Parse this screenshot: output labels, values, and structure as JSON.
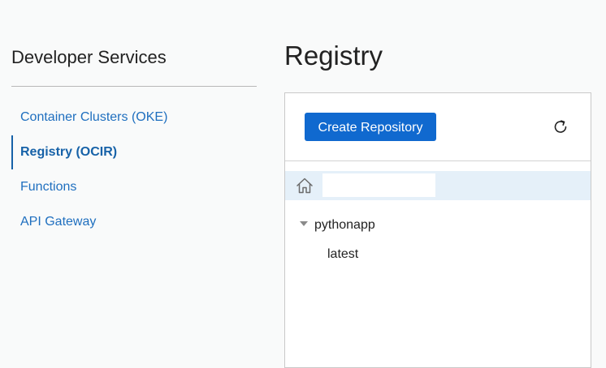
{
  "sidebar": {
    "title": "Developer Services",
    "items": [
      {
        "label": "Container Clusters (OKE)",
        "active": false
      },
      {
        "label": "Registry (OCIR)",
        "active": true
      },
      {
        "label": "Functions",
        "active": false
      },
      {
        "label": "API Gateway",
        "active": false
      }
    ]
  },
  "main": {
    "title": "Registry",
    "toolbar": {
      "create_label": "Create Repository",
      "refresh_icon": "refresh-icon"
    },
    "breadcrumb": {
      "home_icon": "home-icon",
      "input_value": ""
    },
    "tree": {
      "repository": "pythonapp",
      "expanded": true,
      "tags": [
        "latest"
      ]
    }
  },
  "colors": {
    "accent": "#1069cf",
    "link": "#1f6fbf",
    "breadcrumb_bg": "#e5f0f9",
    "page_bg": "#f9fafa"
  }
}
